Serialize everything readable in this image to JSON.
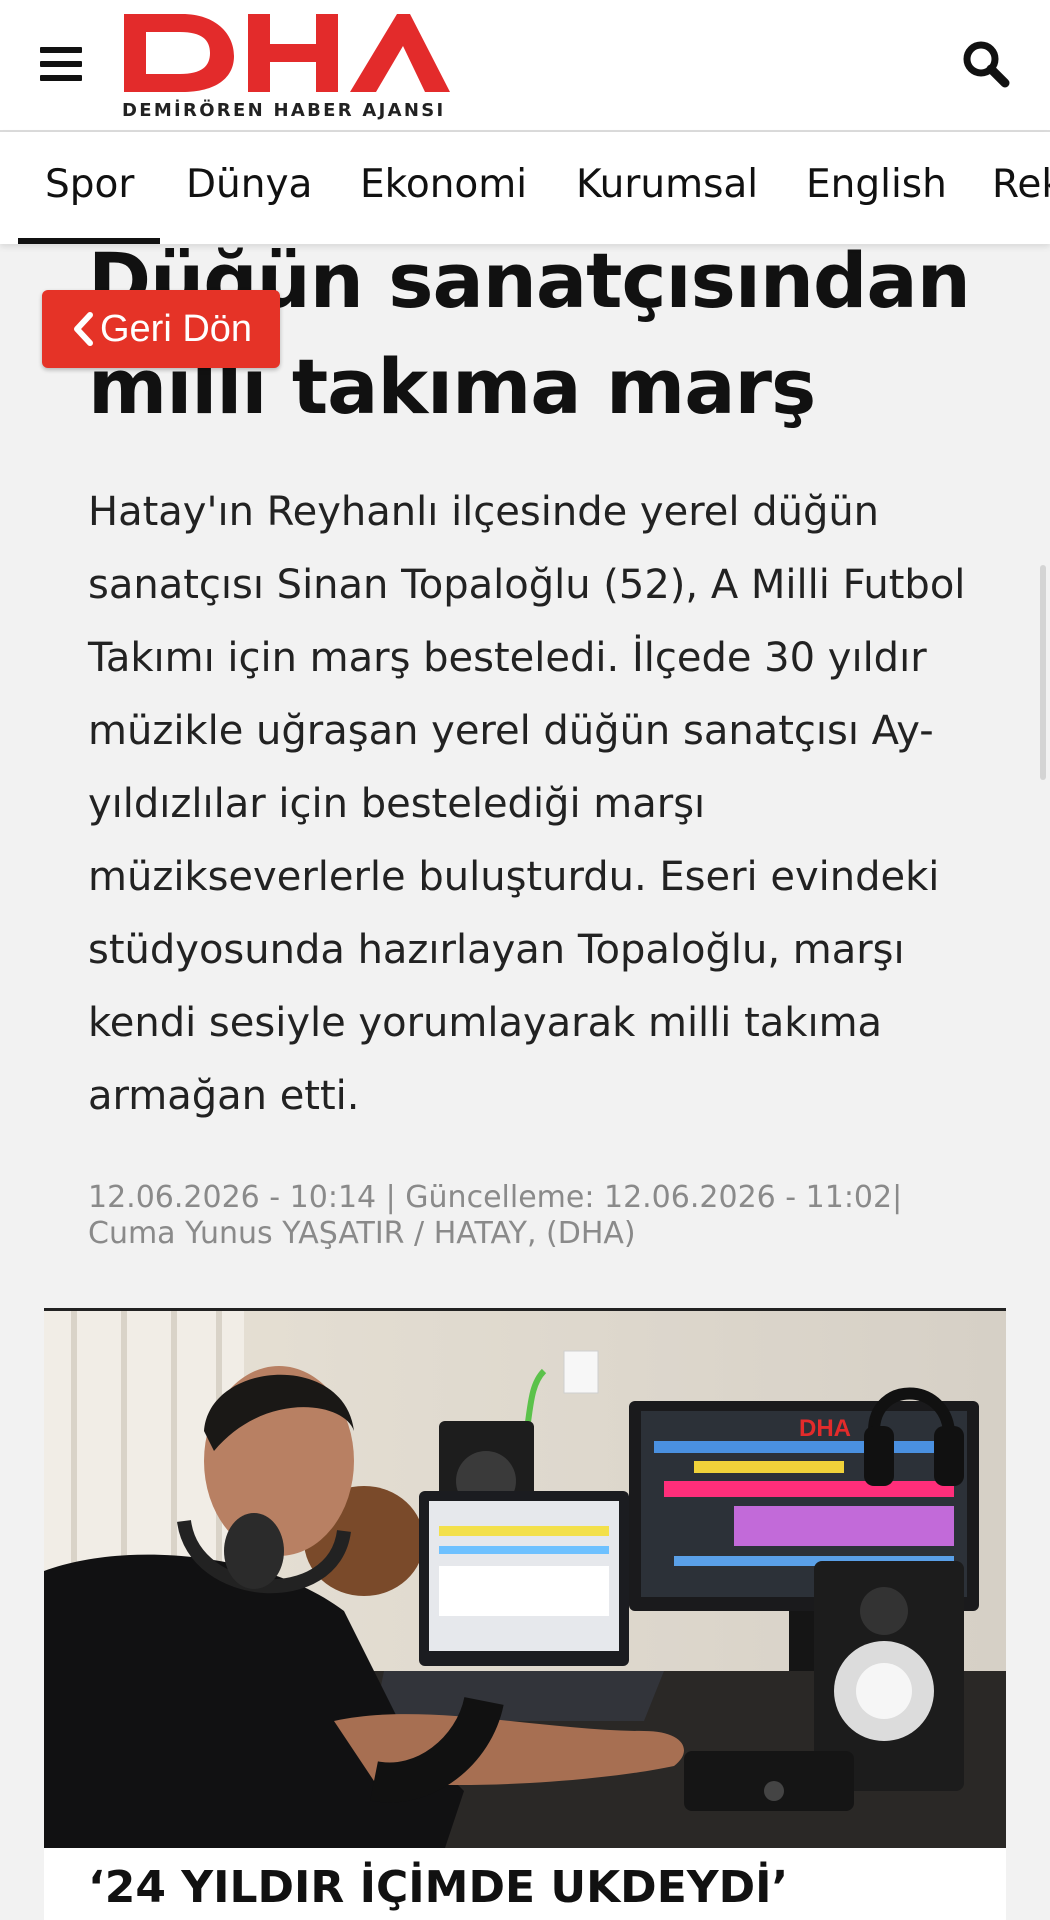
{
  "header": {
    "logo_text": "DHA",
    "logo_tagline": "DEMİRÖREN HABER AJANSI",
    "brand_color": "#e32b2b",
    "menu_icon": "hamburger-menu-icon",
    "search_icon": "magnifier-search-icon"
  },
  "nav": {
    "tabs": [
      "Spor",
      "Dünya",
      "Ekonomi",
      "Kurumsal",
      "English",
      "Rek"
    ],
    "active_tab": "Spor"
  },
  "article": {
    "back_label": "Geri Dön",
    "back_icon": "chevron-left-icon",
    "title": "Düğün sanatçısından milli takıma marş",
    "summary": "Hatay'ın Reyhanlı ilçesinde yerel düğün sanatçısı Sinan Topaloğlu (52), A Milli Futbol Takımı için marş besteledi. İlçede 30 yıldır müzikle uğraşan yerel düğün sanatçısı Ay-yıldızlılar için bestelediği marşı müzikseverlerle buluşturdu. Eseri evindeki stüdyosunda hazırlayan Topaloğlu, marşı kendi sesiyle yorumlayarak milli takıma armağan etti.",
    "meta_line1": "12.06.2026 - 10:14 | Güncelleme: 12.06.2026 - 11:02|",
    "meta_line2": "Cuma Yunus YAŞATIR / HATAY, (DHA)",
    "photo_watermark": "DHA",
    "subheading": "‘24 YILDIR İÇİMDE UKDEYDİ’"
  },
  "colors": {
    "accent_red": "#e53327",
    "page_background": "#f2f2f2",
    "meta_gray": "#8a8a8a"
  }
}
